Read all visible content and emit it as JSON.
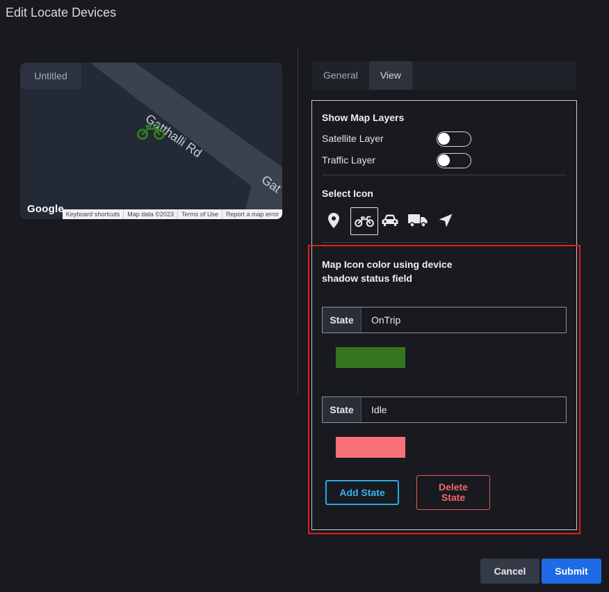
{
  "dialog": {
    "title": "Edit Locate Devices"
  },
  "map": {
    "tab_label": "Untitled",
    "road_name": "Gatthalli Rd",
    "road_name_partial": "Gat",
    "google_label": "Google",
    "attribution": [
      "Keyboard shortcuts",
      "Map data ©2023",
      "Terms of Use",
      "Report a map error"
    ],
    "marker_icon": "motorcycle-icon",
    "marker_color": "#2e7d22"
  },
  "tabs": [
    {
      "label": "General",
      "active": false
    },
    {
      "label": "View",
      "active": true
    }
  ],
  "map_layers": {
    "title": "Show Map Layers",
    "items": [
      {
        "label": "Satellite Layer",
        "enabled": false
      },
      {
        "label": "Traffic Layer",
        "enabled": false
      }
    ]
  },
  "select_icon": {
    "title": "Select Icon",
    "icons": [
      "map-pin-icon",
      "motorcycle-icon",
      "car-icon",
      "truck-icon",
      "navigation-arrow-icon"
    ],
    "selected": "motorcycle-icon"
  },
  "color_config": {
    "title_line1": "Map Icon color using device",
    "title_line2": "shadow status field",
    "states": [
      {
        "prefix": "State",
        "value": "OnTrip",
        "color": "#347520"
      },
      {
        "prefix": "State",
        "value": "Idle",
        "color": "#f87178"
      }
    ],
    "add_label": "Add State",
    "delete_line1": "Delete",
    "delete_line2": "State"
  },
  "footer": {
    "cancel_label": "Cancel",
    "submit_label": "Submit"
  }
}
